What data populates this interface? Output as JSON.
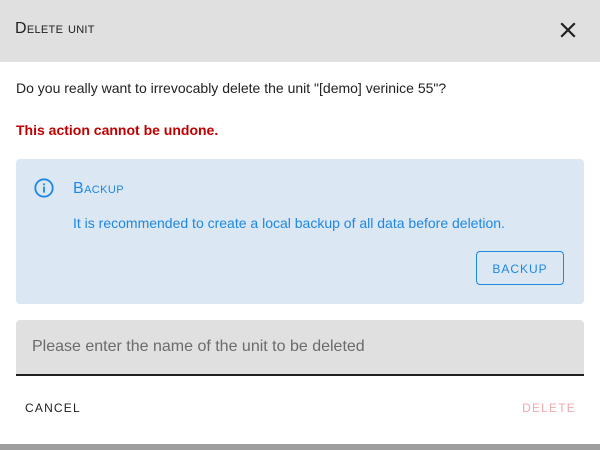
{
  "dialog": {
    "title": "Delete unit",
    "close_icon": "close-icon",
    "question": "Do you really want to irrevocably delete the unit \"[demo] verinice 55\"?",
    "warning": "This action cannot be undone.",
    "info": {
      "icon": "info-circle-icon",
      "title": "Backup",
      "text": "It is recommended to create a local backup of all data before deletion.",
      "button_label": "BACKUP"
    },
    "name_field": {
      "value": "",
      "placeholder": "Please enter the name of the unit to be deleted"
    },
    "actions": {
      "cancel_label": "CANCEL",
      "delete_label": "DELETE"
    }
  },
  "colors": {
    "header_bg": "#e0e0e0",
    "warning": "#c00000",
    "info_bg": "#dbe7f2",
    "info_accent": "#1e88e5",
    "delete_disabled": "#f0aaaa",
    "overlay": "#9e9e9e"
  }
}
